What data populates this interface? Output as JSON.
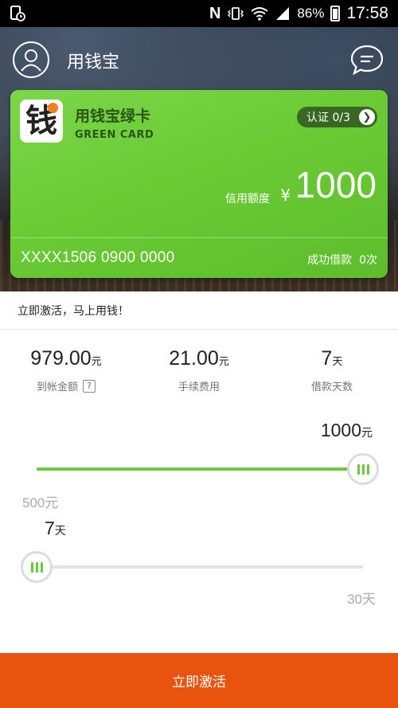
{
  "status_bar": {
    "battery": "86%",
    "time": "17:58"
  },
  "header": {
    "title": "用钱宝"
  },
  "card": {
    "logo_char": "钱",
    "name": "用钱宝绿卡",
    "subtitle": "GREEN CARD",
    "cert_label": "认证 0/3",
    "limit_label": "信用额度",
    "currency": "¥",
    "limit_value": "1000",
    "number": "XXXX1506 0900 0000",
    "loans_label": "成功借款",
    "loans_count": "0次"
  },
  "notice": "立即激活，马上用钱！",
  "stats": [
    {
      "value": "979.00",
      "unit": "元",
      "label": "到帐金额",
      "has_help": true
    },
    {
      "value": "21.00",
      "unit": "元",
      "label": "手续费用",
      "has_help": false
    },
    {
      "value": "7",
      "unit": "天",
      "label": "借款天数",
      "has_help": false
    }
  ],
  "amount_slider": {
    "value": "1000",
    "unit": "元",
    "min_label": "500元",
    "level": 1.0
  },
  "days_slider": {
    "value": "7",
    "unit": "天",
    "max_label": "30天",
    "level": 0.0
  },
  "cta_label": "立即激活",
  "colors": {
    "accent": "#6ac93b",
    "card": "#6acb35",
    "cta": "#e8540e"
  }
}
